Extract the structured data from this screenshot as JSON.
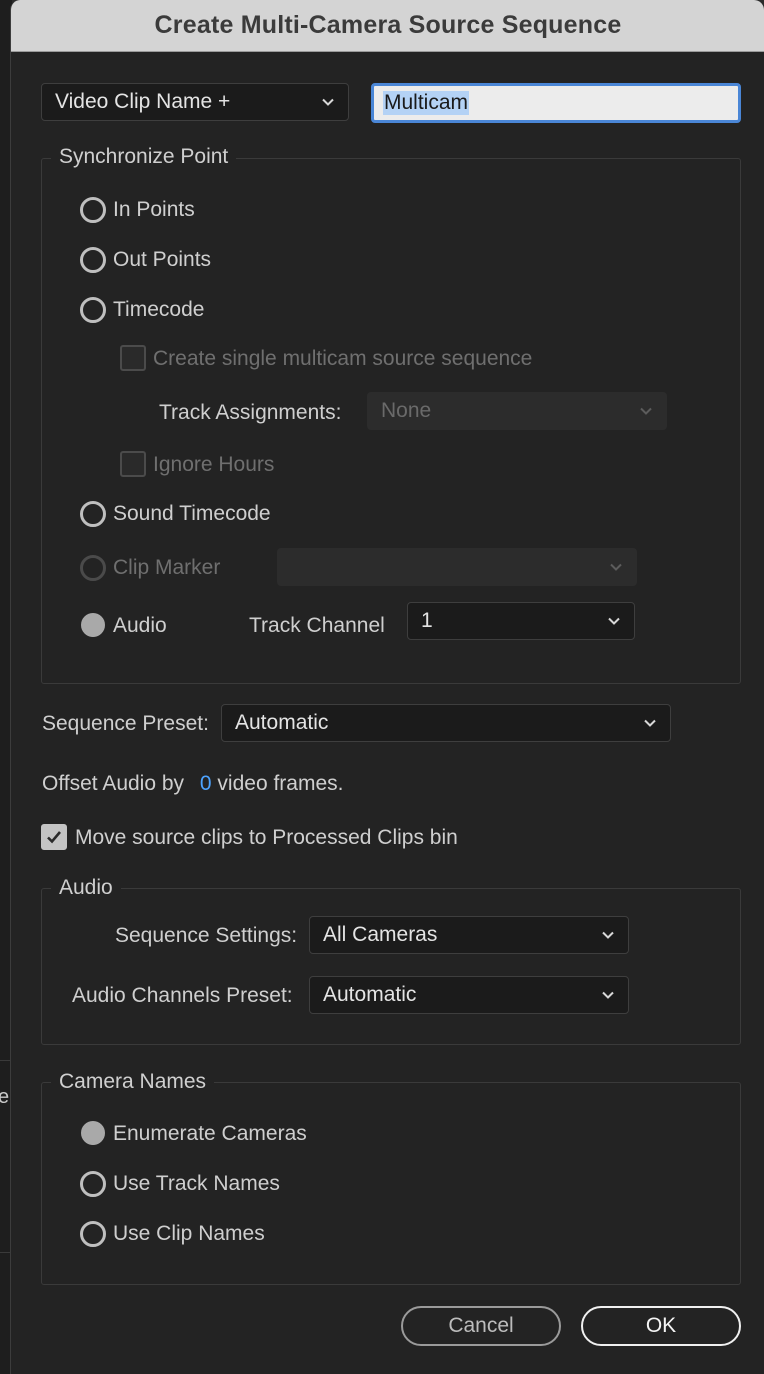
{
  "dialog": {
    "title": "Create Multi-Camera Source Sequence"
  },
  "name": {
    "mode_select": "Video Clip Name +",
    "field_value": "Multicam"
  },
  "sync": {
    "legend": "Synchronize Point",
    "in_points": "In Points",
    "out_points": "Out Points",
    "timecode": "Timecode",
    "single_sequence": "Create single multicam source sequence",
    "track_assignments_label": "Track Assignments:",
    "track_assignments_value": "None",
    "ignore_hours": "Ignore Hours",
    "sound_timecode": "Sound Timecode",
    "clip_marker": "Clip Marker",
    "clip_marker_value": "",
    "audio": "Audio",
    "track_channel_label": "Track Channel",
    "track_channel_value": "1",
    "selected": "Audio"
  },
  "sequence_preset": {
    "label": "Sequence Preset:",
    "value": "Automatic"
  },
  "offset_audio": {
    "prefix": "Offset Audio by",
    "value": "0",
    "suffix": "video frames."
  },
  "move_clips": {
    "label": "Move source clips to Processed Clips bin",
    "checked": true
  },
  "audio": {
    "legend": "Audio",
    "sequence_settings_label": "Sequence Settings:",
    "sequence_settings_value": "All Cameras",
    "channels_preset_label": "Audio Channels Preset:",
    "channels_preset_value": "Automatic"
  },
  "camera_names": {
    "legend": "Camera Names",
    "enumerate": "Enumerate Cameras",
    "track_names": "Use Track Names",
    "clip_names": "Use Clip Names",
    "selected": "Enumerate Cameras"
  },
  "buttons": {
    "cancel": "Cancel",
    "ok": "OK"
  },
  "background_fragment": "e",
  "colors": {
    "title_bar": "#d4d4d4",
    "dialog_bg": "#232323",
    "accent_blue": "#4da3ff",
    "input_focus": "#4a86d6"
  }
}
